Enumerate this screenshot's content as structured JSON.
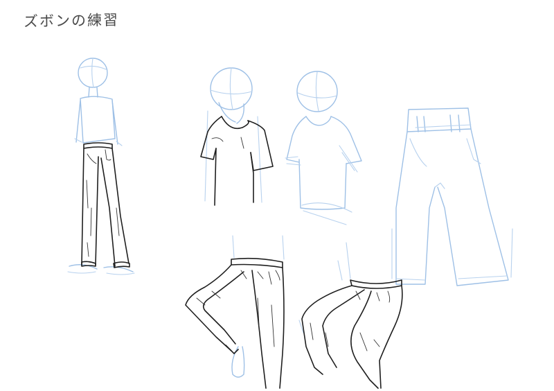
{
  "title": "ズボンの練習",
  "colors": {
    "background": "#ffffff",
    "sketch_line": "#9ec0e6",
    "ink_line": "#1e1e1e",
    "title_text": "#4a4a4a"
  }
}
